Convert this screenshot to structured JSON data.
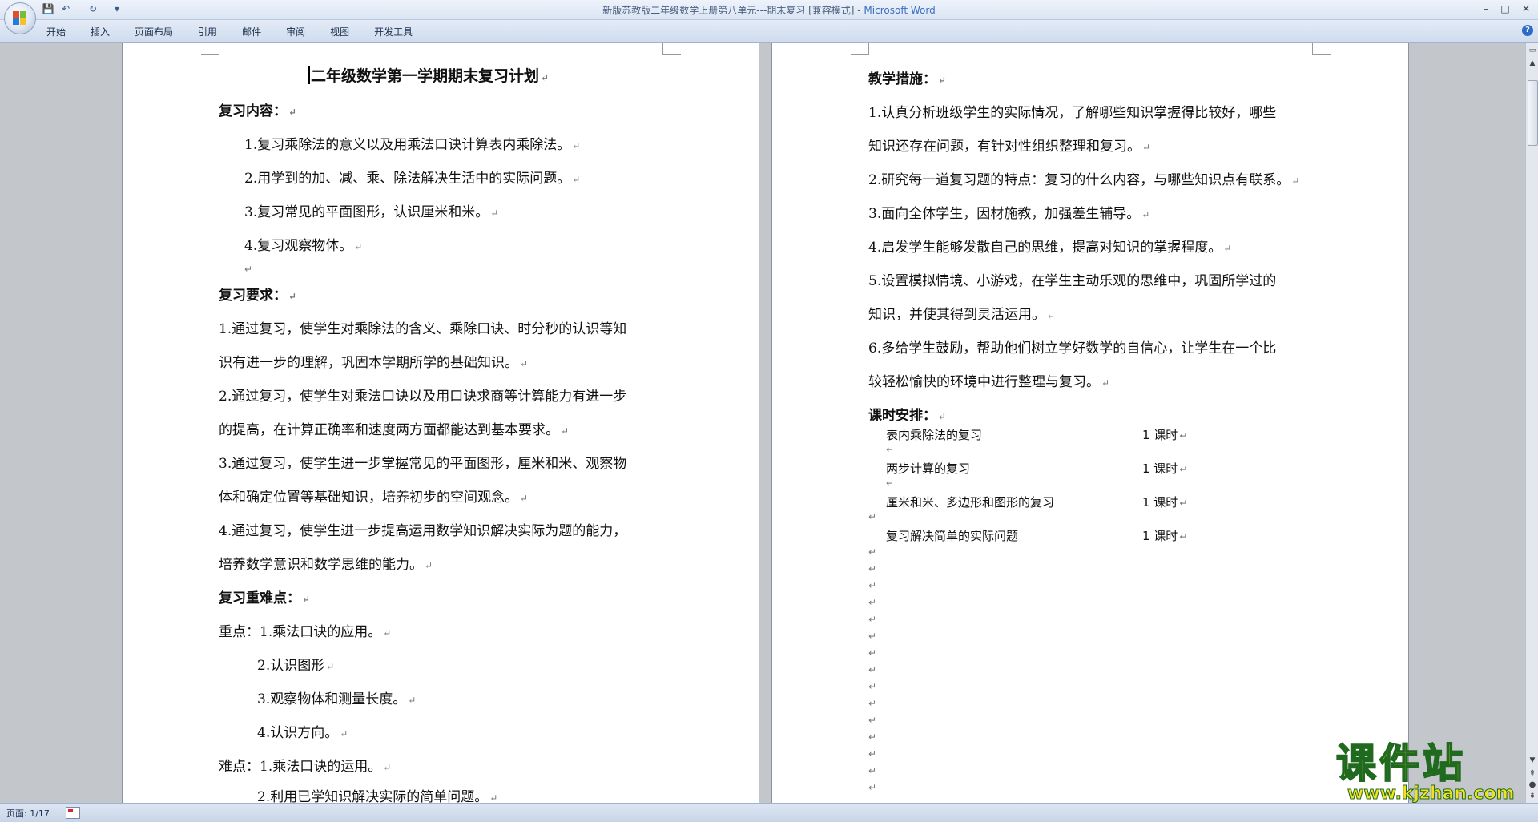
{
  "window": {
    "title": "新版苏教版二年级数学上册第八单元---期末复习 [兼容模式] - ",
    "app_name": "Microsoft Word",
    "minimize": "–",
    "maximize": "□",
    "close": "✕"
  },
  "quick_access": {
    "save": "💾",
    "undo": "↶",
    "redo": "↻",
    "more": "▾"
  },
  "ribbon": {
    "tabs": [
      "开始",
      "插入",
      "页面布局",
      "引用",
      "邮件",
      "审阅",
      "视图",
      "开发工具"
    ],
    "help": "?"
  },
  "paragraph_mark": "↵",
  "page1": {
    "title": "二年级数学第一学期期末复习计划",
    "review_content_heading": "复习内容：",
    "review_content": [
      "1.复习乘除法的意义以及用乘法口诀计算表内乘除法。",
      "2.用学到的加、减、乘、除法解决生活中的实际问题。",
      "3.复习常见的平面图形，认识厘米和米。",
      "4.复习观察物体。"
    ],
    "requirements_heading": "复习要求：",
    "requirements_lines": [
      "1.通过复习，使学生对乘除法的含义、乘除口诀、时分秒的认识等知",
      "识有进一步的理解，巩固本学期所学的基础知识。",
      "2.通过复习，使学生对乘法口诀以及用口诀求商等计算能力有进一步",
      "的提高，在计算正确率和速度两方面都能达到基本要求。",
      "3.通过复习，使学生进一步掌握常见的平面图形，厘米和米、观察物",
      "体和确定位置等基础知识，培养初步的空间观念。",
      "4.通过复习，使学生进一步提高运用数学知识解决实际为题的能力，",
      "培养数学意识和数学思维的能力。"
    ],
    "key_points_heading": "复习重难点：",
    "key_points": [
      "重点：1.乘法口诀的应用。",
      "2.认识图形",
      "3.观察物体和测量长度。",
      "4.认识方向。",
      "难点：1.乘法口诀的运用。",
      "2.利用已学知识解决实际的简单问题。"
    ]
  },
  "page2": {
    "measures_heading": "教学措施：",
    "measures_lines": [
      "1.认真分析班级学生的实际情况，了解哪些知识掌握得比较好，哪些",
      "知识还存在问题，有针对性组织整理和复习。",
      "2.研究每一道复习题的特点：复习的什么内容，与哪些知识点有联系。",
      "3.面向全体学生，因材施教，加强差生辅导。",
      "4.启发学生能够发散自己的思维，提高对知识的掌握程度。",
      "5.设置模拟情境、小游戏，在学生主动乐观的思维中，巩固所学过的",
      "知识，并使其得到灵活运用。",
      "6.多给学生鼓励，帮助他们树立学好数学的自信心，让学生在一个比",
      "较轻松愉快的环境中进行整理与复习。"
    ],
    "schedule_heading": "课时安排：",
    "schedule": [
      {
        "topic": "表内乘除法的复习",
        "hours": "1 课时"
      },
      {
        "topic": "两步计算的复习",
        "hours": "1 课时"
      },
      {
        "topic": "厘米和米、多边形和图形的复习",
        "hours": "1 课时"
      },
      {
        "topic": "复习解决简单的实际问题",
        "hours": "1 课时"
      }
    ]
  },
  "status_bar": {
    "page": "页面: 1/17"
  },
  "watermark": {
    "name": "课件站",
    "url": "www.kjzhan.com"
  },
  "colors": {
    "ribbon": "#dbe5f3",
    "page_bg": "#c3c6cb",
    "watermark_fill": "#f2e21f",
    "watermark_stroke": "#1f6a1f"
  }
}
